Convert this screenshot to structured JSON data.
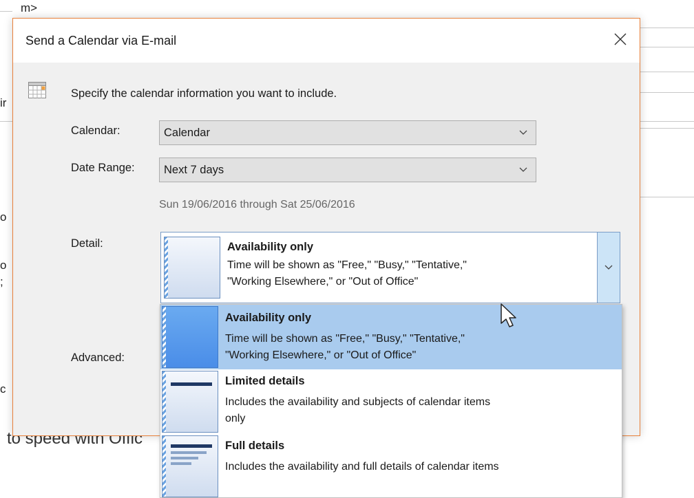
{
  "background": {
    "frag_top": "m>",
    "frag_ir": "ir",
    "frag_o": "o",
    "frag_o2": "o",
    "frag_semicolon": ";",
    "frag_c": "c",
    "bottom_text": "to speed with Offic"
  },
  "dialog": {
    "title": "Send a Calendar via E-mail",
    "close_glyph": "✕",
    "instruction": "Specify the calendar information you want to include.",
    "calendar_label": "Calendar:",
    "calendar_value": "Calendar",
    "date_range_label": "Date Range:",
    "date_range_value": "Next 7 days",
    "date_range_hint": "Sun 19/06/2016 through Sat 25/06/2016",
    "detail_label": "Detail:",
    "advanced_label": "Advanced:",
    "detail_selected": {
      "title": "Availability only",
      "desc_line1": "Time will be shown as \"Free,\" \"Busy,\" \"Tentative,\"",
      "desc_line2": "\"Working Elsewhere,\" or \"Out of Office\""
    }
  },
  "dropdown": {
    "options": [
      {
        "title": "Availability only",
        "desc_line1": "Time will be shown as \"Free,\" \"Busy,\" \"Tentative,\"",
        "desc_line2": "\"Working Elsewhere,\" or \"Out of Office\""
      },
      {
        "title": "Limited details",
        "desc_line1": "Includes the availability and subjects of calendar items",
        "desc_line2": "only"
      },
      {
        "title": "Full details",
        "desc_line1": "Includes the availability and full details of calendar items",
        "desc_line2": ""
      }
    ]
  },
  "icons": {
    "calendar": "calendar-icon",
    "chevron": "chevron-down-icon",
    "close": "close-icon",
    "pointer": "mouse-pointer-icon"
  },
  "colors": {
    "dialog_border": "#e8803a",
    "selection": "#a9cbee",
    "combobox_accent": "#cce4f7"
  }
}
